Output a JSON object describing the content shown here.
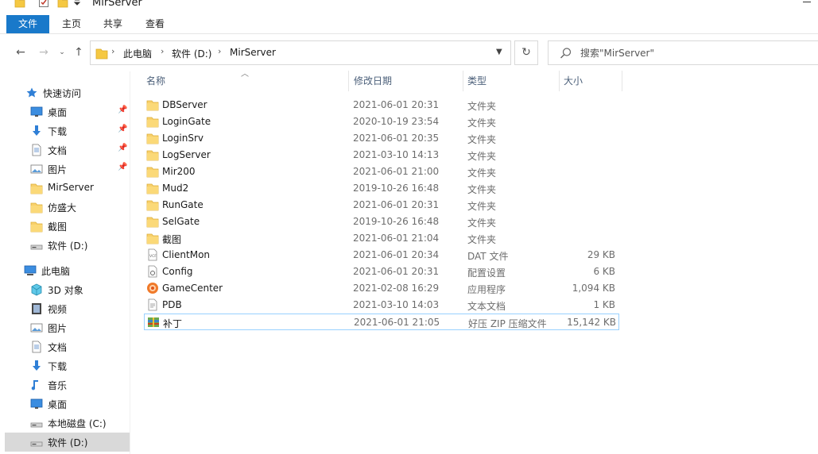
{
  "window": {
    "title": "MirServer"
  },
  "ribbon": {
    "tabs": [
      "文件",
      "主页",
      "共享",
      "查看"
    ]
  },
  "address": {
    "crumbs": [
      "此电脑",
      "软件 (D:)",
      "MirServer"
    ]
  },
  "search": {
    "placeholder": "搜索\"MirServer\""
  },
  "navpane": {
    "quick_access_label": "快速访问",
    "quick_items": [
      {
        "label": "桌面",
        "icon": "desktop-icon",
        "pinned": true
      },
      {
        "label": "下载",
        "icon": "download-icon",
        "pinned": true
      },
      {
        "label": "文档",
        "icon": "document-icon",
        "pinned": true
      },
      {
        "label": "图片",
        "icon": "pictures-icon",
        "pinned": true
      },
      {
        "label": "MirServer",
        "icon": "folder-icon",
        "pinned": false
      },
      {
        "label": "仿盛大",
        "icon": "folder-icon",
        "pinned": false
      },
      {
        "label": "截图",
        "icon": "folder-icon",
        "pinned": false
      },
      {
        "label": "软件 (D:)",
        "icon": "drive-icon",
        "pinned": false
      }
    ],
    "this_pc_label": "此电脑",
    "pc_items": [
      {
        "label": "3D 对象",
        "icon": "3d-objects-icon"
      },
      {
        "label": "视频",
        "icon": "video-icon"
      },
      {
        "label": "图片",
        "icon": "pictures-icon"
      },
      {
        "label": "文档",
        "icon": "document-icon"
      },
      {
        "label": "下载",
        "icon": "download-icon"
      },
      {
        "label": "音乐",
        "icon": "music-icon"
      },
      {
        "label": "桌面",
        "icon": "desktop-icon"
      },
      {
        "label": "本地磁盘 (C:)",
        "icon": "drive-icon"
      },
      {
        "label": "软件 (D:)",
        "icon": "drive-icon",
        "selected": true
      }
    ]
  },
  "columns": {
    "name": "名称",
    "date": "修改日期",
    "type": "类型",
    "size": "大小"
  },
  "files": [
    {
      "name": "DBServer",
      "date": "2021-06-01 20:31",
      "type": "文件夹",
      "size": "",
      "icon": "folder-icon"
    },
    {
      "name": "LoginGate",
      "date": "2020-10-19 23:54",
      "type": "文件夹",
      "size": "",
      "icon": "folder-icon"
    },
    {
      "name": "LoginSrv",
      "date": "2021-06-01 20:35",
      "type": "文件夹",
      "size": "",
      "icon": "folder-icon"
    },
    {
      "name": "LogServer",
      "date": "2021-03-10 14:13",
      "type": "文件夹",
      "size": "",
      "icon": "folder-icon"
    },
    {
      "name": "Mir200",
      "date": "2021-06-01 21:00",
      "type": "文件夹",
      "size": "",
      "icon": "folder-icon"
    },
    {
      "name": "Mud2",
      "date": "2019-10-26 16:48",
      "type": "文件夹",
      "size": "",
      "icon": "folder-icon"
    },
    {
      "name": "RunGate",
      "date": "2021-06-01 20:31",
      "type": "文件夹",
      "size": "",
      "icon": "folder-icon"
    },
    {
      "name": "SelGate",
      "date": "2019-10-26 16:48",
      "type": "文件夹",
      "size": "",
      "icon": "folder-icon"
    },
    {
      "name": "截图",
      "date": "2021-06-01 21:04",
      "type": "文件夹",
      "size": "",
      "icon": "folder-icon"
    },
    {
      "name": "ClientMon",
      "date": "2021-06-01 20:34",
      "type": "DAT 文件",
      "size": "29 KB",
      "icon": "dat-file-icon"
    },
    {
      "name": "Config",
      "date": "2021-06-01 20:31",
      "type": "配置设置",
      "size": "6 KB",
      "icon": "config-file-icon"
    },
    {
      "name": "GameCenter",
      "date": "2021-02-08 16:29",
      "type": "应用程序",
      "size": "1,094 KB",
      "icon": "app-icon"
    },
    {
      "name": "PDB",
      "date": "2021-03-10 14:03",
      "type": "文本文档",
      "size": "1 KB",
      "icon": "text-file-icon"
    },
    {
      "name": "补丁",
      "date": "2021-06-01 21:05",
      "type": "好压 ZIP 压缩文件",
      "size": "15,142 KB",
      "icon": "zip-archive-icon",
      "focused": true
    }
  ]
}
